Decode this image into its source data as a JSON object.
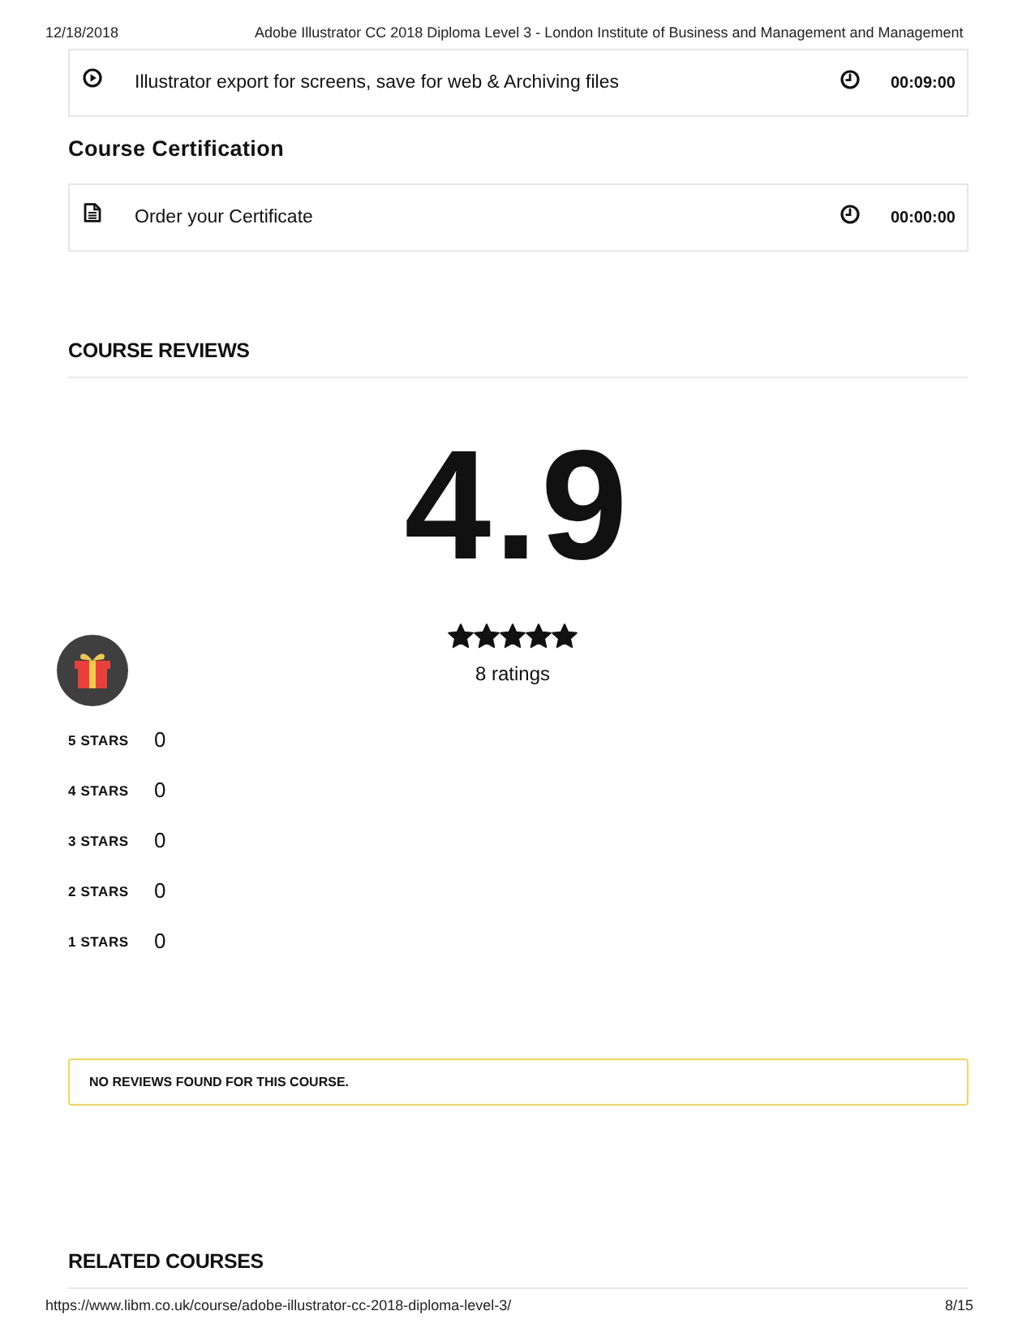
{
  "print_header": {
    "date": "12/18/2018",
    "title": "Adobe Illustrator CC 2018 Diploma Level 3 - London Institute of Business and Management and Management"
  },
  "curriculum": [
    {
      "kind": "video",
      "title": "Illustrator export for screens, save for web & Archiving files",
      "duration": "00:09:00"
    },
    {
      "kind": "section",
      "title": "Course Certification"
    },
    {
      "kind": "document",
      "title": "Order your Certificate",
      "duration": "00:00:00"
    }
  ],
  "reviews": {
    "heading": "COURSE REVIEWS",
    "average": "4.9",
    "stars": 5,
    "ratings": "8 ratings",
    "breakdown": [
      {
        "label": "5 STARS",
        "count": "0"
      },
      {
        "label": "4 STARS",
        "count": "0"
      },
      {
        "label": "3 STARS",
        "count": "0"
      },
      {
        "label": "2 STARS",
        "count": "0"
      },
      {
        "label": "1 STARS",
        "count": "0"
      }
    ],
    "notice": "NO REVIEWS FOUND FOR THIS COURSE."
  },
  "related": {
    "heading": "RELATED COURSES"
  },
  "print_footer": {
    "url": "https://www.libm.co.uk/course/adobe-illustrator-cc-2018-diploma-level-3/",
    "page": "8/15"
  }
}
